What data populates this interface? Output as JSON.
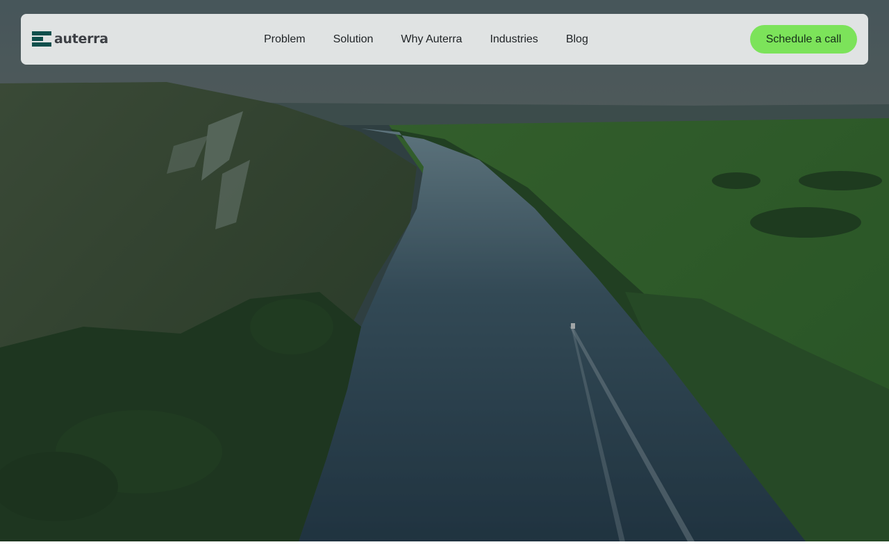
{
  "brand": {
    "name": "auterra",
    "logo_icon": "stacked-bars-logo",
    "logo_color": "#0f4f4c"
  },
  "nav": {
    "items": [
      {
        "label": "Problem"
      },
      {
        "label": "Solution"
      },
      {
        "label": "Why Auterra"
      },
      {
        "label": "Industries"
      },
      {
        "label": "Blog"
      }
    ]
  },
  "cta": {
    "label": "Schedule a call",
    "color": "#7ce35a"
  },
  "hero": {
    "image_subject": "aerial river valley with a boat",
    "overlay_color": "#1c2a2e"
  }
}
